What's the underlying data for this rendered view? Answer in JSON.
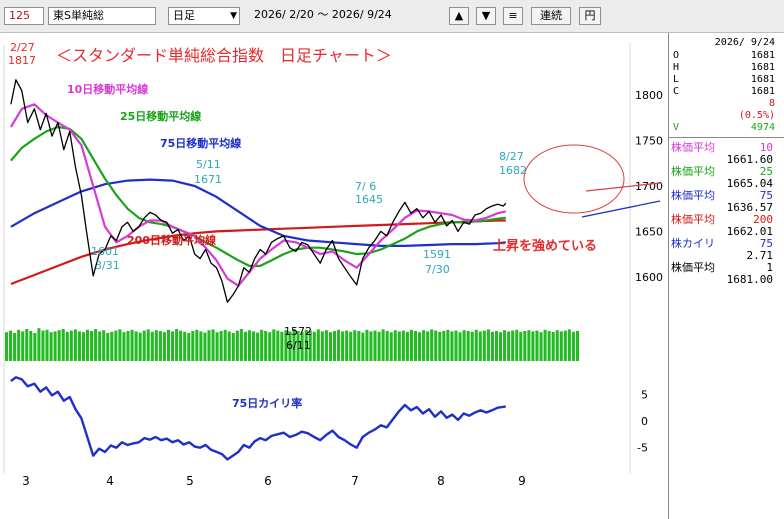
{
  "toolbar": {
    "code": "125",
    "name": "東S単純総",
    "period": "日足",
    "range": "2026/ 2/20 ～  2026/ 9/24",
    "up_icon": "triangle-up-icon",
    "down_icon": "triangle-down-icon",
    "menu_icon": "menu-icon",
    "continuous_label": "連続",
    "yen_label": "円"
  },
  "ohlc": {
    "date": "2026/ 9/24",
    "o_label": "O",
    "o": "1681",
    "h_label": "H",
    "h": "1681",
    "l_label": "L",
    "l": "1681",
    "c_label": "C",
    "c": "1681",
    "change": "8",
    "change_pct": "(0.5%)",
    "v_label": "V",
    "v": "4974"
  },
  "indicators": [
    {
      "label": "株価平均",
      "period": "10",
      "value": "1661.60",
      "color": "#d63bd6"
    },
    {
      "label": "株価平均",
      "period": "25",
      "value": "1665.04",
      "color": "#1aa31a"
    },
    {
      "label": "株価平均",
      "period": "75",
      "value": "1636.57",
      "color": "#1f2fc8"
    },
    {
      "label": "株価平均",
      "period": "200",
      "value": "1662.01",
      "color": "#d11a1a"
    },
    {
      "label": "株カイリ",
      "period": "75",
      "value": "2.71",
      "color": "#1f2fc8"
    },
    {
      "label": "株価平均",
      "period": "1",
      "value": "1681.00",
      "color": "#000000"
    }
  ],
  "annotations": {
    "title": "＜スタンダード単純総合指数　日足チャート＞",
    "ma10": "10日移動平均線",
    "ma25": "25日移動平均線",
    "ma75": "75日移動平均線",
    "ma200": "200日移動平均線",
    "kairi": "75日カイリ率",
    "trend": "上昇を強めている",
    "p1_date": "2/27",
    "p1_val": "1817",
    "p2_date": "5/11",
    "p2_val": "1671",
    "p3_val": "1601",
    "p3_date": "3/31",
    "p4_val": "1572",
    "p4_date": "6/11",
    "p5_date": "7/ 6",
    "p5_val": "1645",
    "p6_val": "1591",
    "p6_date": "7/30",
    "p7_date": "8/27",
    "p7_val": "1682"
  },
  "chart_data": [
    {
      "type": "line",
      "title": "＜スタンダード単純総合指数　日足チャート＞",
      "x_labels": [
        "3",
        "4",
        "5",
        "6",
        "7",
        "8",
        "9"
      ],
      "ylim": [
        1570,
        1830
      ],
      "yticks": [
        1600,
        1650,
        1700,
        1750,
        1800
      ],
      "grid": false,
      "series": [
        {
          "name": "",
          "color": "#000000",
          "x": [
            2.82,
            2.88,
            2.95,
            3.02,
            3.1,
            3.17,
            3.24,
            3.31,
            3.38,
            3.45,
            3.52,
            3.59,
            3.66,
            3.72,
            3.8,
            3.87,
            3.94,
            4.01,
            4.08,
            4.15,
            4.22,
            4.29,
            4.36,
            4.43,
            4.5,
            4.57,
            4.64,
            4.71,
            4.78,
            4.85,
            4.92,
            4.99,
            5.06,
            5.13,
            5.2,
            5.27,
            5.34,
            5.41,
            5.48,
            5.55,
            5.62,
            5.69,
            5.76,
            5.83,
            5.9,
            5.97,
            6.04,
            6.11,
            6.18,
            6.25,
            6.32,
            6.39,
            6.46,
            6.53,
            6.6,
            6.67,
            6.74,
            6.81,
            6.88,
            6.95,
            7.02,
            7.09,
            7.16,
            7.23,
            7.3,
            7.37,
            7.44,
            7.51,
            7.58,
            7.65,
            7.72,
            7.79,
            7.86,
            7.93,
            8.0,
            8.07,
            8.14,
            8.21,
            8.28,
            8.35,
            8.42,
            8.49,
            8.56,
            8.63,
            8.7,
            8.77,
            8.8
          ],
          "y": [
            1790,
            1817,
            1805,
            1770,
            1785,
            1762,
            1780,
            1755,
            1770,
            1740,
            1760,
            1720,
            1690,
            1650,
            1601,
            1625,
            1630,
            1645,
            1640,
            1655,
            1660,
            1650,
            1655,
            1665,
            1671,
            1668,
            1662,
            1660,
            1648,
            1652,
            1640,
            1645,
            1625,
            1620,
            1630,
            1615,
            1610,
            1595,
            1572,
            1580,
            1590,
            1610,
            1605,
            1620,
            1630,
            1625,
            1638,
            1642,
            1645,
            1632,
            1628,
            1638,
            1635,
            1625,
            1615,
            1630,
            1640,
            1620,
            1610,
            1600,
            1591,
            1620,
            1632,
            1640,
            1650,
            1645,
            1660,
            1672,
            1682,
            1670,
            1675,
            1665,
            1672,
            1660,
            1668,
            1656,
            1662,
            1650,
            1660,
            1658,
            1668,
            1670,
            1675,
            1678,
            1680,
            1678,
            1681
          ]
        },
        {
          "name": "",
          "color": "#d63bd6",
          "x": [
            2.82,
            2.95,
            3.1,
            3.24,
            3.38,
            3.52,
            3.66,
            3.8,
            3.94,
            4.08,
            4.22,
            4.36,
            4.5,
            4.64,
            4.78,
            4.92,
            5.06,
            5.2,
            5.34,
            5.48,
            5.62,
            5.76,
            5.9,
            6.04,
            6.18,
            6.32,
            6.46,
            6.6,
            6.74,
            6.88,
            7.02,
            7.16,
            7.3,
            7.44,
            7.58,
            7.72,
            7.86,
            8.0,
            8.14,
            8.28,
            8.42,
            8.56,
            8.7,
            8.8
          ],
          "y": [
            1765,
            1785,
            1790,
            1778,
            1770,
            1762,
            1745,
            1700,
            1655,
            1638,
            1645,
            1655,
            1662,
            1662,
            1655,
            1650,
            1645,
            1632,
            1618,
            1598,
            1590,
            1605,
            1620,
            1630,
            1640,
            1638,
            1632,
            1625,
            1628,
            1618,
            1610,
            1625,
            1640,
            1652,
            1665,
            1673,
            1672,
            1670,
            1668,
            1663,
            1662,
            1665,
            1670,
            1672
          ]
        },
        {
          "name": "",
          "color": "#1aa31a",
          "x": [
            2.82,
            2.95,
            3.1,
            3.24,
            3.38,
            3.52,
            3.66,
            3.8,
            3.94,
            4.08,
            4.22,
            4.36,
            4.5,
            4.64,
            4.78,
            4.92,
            5.06,
            5.2,
            5.34,
            5.48,
            5.62,
            5.76,
            5.9,
            6.04,
            6.18,
            6.32,
            6.46,
            6.6,
            6.74,
            6.88,
            7.02,
            7.16,
            7.3,
            7.44,
            7.58,
            7.72,
            7.86,
            8.0,
            8.14,
            8.28,
            8.42,
            8.56,
            8.7,
            8.8
          ],
          "y": [
            1728,
            1742,
            1752,
            1760,
            1765,
            1763,
            1752,
            1730,
            1708,
            1690,
            1675,
            1665,
            1660,
            1658,
            1655,
            1650,
            1645,
            1638,
            1632,
            1625,
            1618,
            1612,
            1612,
            1618,
            1625,
            1630,
            1632,
            1632,
            1630,
            1628,
            1625,
            1626,
            1630,
            1636,
            1642,
            1650,
            1655,
            1658,
            1660,
            1660,
            1661,
            1662,
            1664,
            1665
          ]
        },
        {
          "name": "",
          "color": "#1f2fc8",
          "x": [
            2.82,
            3.1,
            3.38,
            3.66,
            3.94,
            4.22,
            4.5,
            4.78,
            5.06,
            5.34,
            5.62,
            5.9,
            6.18,
            6.46,
            6.74,
            7.02,
            7.3,
            7.58,
            7.86,
            8.14,
            8.42,
            8.7,
            8.8
          ],
          "y": [
            1655,
            1670,
            1682,
            1694,
            1702,
            1706,
            1707,
            1706,
            1700,
            1688,
            1672,
            1656,
            1645,
            1640,
            1638,
            1636,
            1634,
            1634,
            1635,
            1636,
            1636,
            1637,
            1638
          ]
        },
        {
          "name": "",
          "color": "#d11a1a",
          "x": [
            2.82,
            3.1,
            3.38,
            3.66,
            3.94,
            4.22,
            4.5,
            4.78,
            5.06,
            5.34,
            5.62,
            5.9,
            6.18,
            6.46,
            6.74,
            7.02,
            7.3,
            7.58,
            7.86,
            8.14,
            8.42,
            8.7,
            8.8
          ],
          "y": [
            1592,
            1602,
            1612,
            1622,
            1630,
            1636,
            1641,
            1645,
            1648,
            1650,
            1651,
            1652,
            1653,
            1654,
            1655,
            1656,
            1657,
            1658,
            1659,
            1660,
            1661,
            1662,
            1662
          ]
        }
      ]
    },
    {
      "type": "bar",
      "title": "",
      "series": [
        {
          "name": "",
          "color": "#22bb22",
          "values": [
            0.72,
            0.76,
            0.7,
            0.78,
            0.74,
            0.8,
            0.75,
            0.7,
            0.82,
            0.76,
            0.78,
            0.72,
            0.74,
            0.77,
            0.8,
            0.73,
            0.76,
            0.79,
            0.74,
            0.72,
            0.78,
            0.75,
            0.8,
            0.74,
            0.77,
            0.7,
            0.73,
            0.76,
            0.79,
            0.72,
            0.75,
            0.78,
            0.74,
            0.71,
            0.76,
            0.79,
            0.73,
            0.77,
            0.75,
            0.72,
            0.78,
            0.74,
            0.8,
            0.76,
            0.73,
            0.7,
            0.75,
            0.78,
            0.74,
            0.71,
            0.77,
            0.79,
            0.72,
            0.75,
            0.78,
            0.74,
            0.7,
            0.76,
            0.8,
            0.73,
            0.77,
            0.74,
            0.71,
            0.78,
            0.75,
            0.72,
            0.79,
            0.76,
            0.73,
            0.77,
            0.74,
            0.8,
            0.75,
            0.72,
            0.78,
            0.76,
            0.73,
            0.79,
            0.74,
            0.77,
            0.72,
            0.75,
            0.78,
            0.74,
            0.76,
            0.73,
            0.77,
            0.75,
            0.71,
            0.78,
            0.74,
            0.76,
            0.73,
            0.79,
            0.75,
            0.72,
            0.77,
            0.74,
            0.76,
            0.73,
            0.78,
            0.75,
            0.72,
            0.77,
            0.74,
            0.79,
            0.76,
            0.73,
            0.75,
            0.78,
            0.74,
            0.76,
            0.72,
            0.77,
            0.75,
            0.73,
            0.78,
            0.74,
            0.76,
            0.79,
            0.73,
            0.75,
            0.72,
            0.77,
            0.74,
            0.76,
            0.78,
            0.73,
            0.75,
            0.77,
            0.74,
            0.76,
            0.72,
            0.78,
            0.75,
            0.73,
            0.77,
            0.74,
            0.76,
            0.79,
            0.73,
            0.75
          ]
        }
      ]
    },
    {
      "type": "line",
      "title": "",
      "ylim": [
        -9,
        9
      ],
      "yticks": [
        5,
        0,
        -5
      ],
      "series": [
        {
          "name": "",
          "color": "#1f2fc8",
          "x": [
            2.82,
            2.88,
            2.95,
            3.02,
            3.1,
            3.17,
            3.24,
            3.31,
            3.38,
            3.45,
            3.52,
            3.59,
            3.66,
            3.73,
            3.8,
            3.87,
            3.94,
            4.01,
            4.08,
            4.15,
            4.22,
            4.29,
            4.36,
            4.43,
            4.5,
            4.57,
            4.64,
            4.71,
            4.78,
            4.85,
            4.92,
            4.99,
            5.06,
            5.13,
            5.2,
            5.27,
            5.34,
            5.41,
            5.48,
            5.55,
            5.62,
            5.69,
            5.76,
            5.83,
            5.9,
            5.97,
            6.04,
            6.11,
            6.18,
            6.25,
            6.32,
            6.39,
            6.46,
            6.53,
            6.6,
            6.67,
            6.74,
            6.81,
            6.88,
            6.95,
            7.02,
            7.09,
            7.16,
            7.23,
            7.3,
            7.37,
            7.44,
            7.51,
            7.58,
            7.65,
            7.72,
            7.79,
            7.86,
            7.93,
            8.0,
            8.07,
            8.14,
            8.21,
            8.28,
            8.35,
            8.42,
            8.49,
            8.56,
            8.63,
            8.7,
            8.8
          ],
          "y": [
            7.5,
            8.2,
            7.8,
            6.5,
            7.0,
            5.5,
            6.3,
            4.8,
            5.5,
            3.8,
            4.5,
            2.2,
            0.5,
            -3.0,
            -6.5,
            -5.2,
            -5.8,
            -4.6,
            -5.0,
            -4.0,
            -4.5,
            -4.2,
            -4.0,
            -3.2,
            -3.5,
            -3.0,
            -3.6,
            -3.3,
            -4.0,
            -3.6,
            -4.4,
            -4.0,
            -4.8,
            -5.0,
            -4.5,
            -5.4,
            -5.8,
            -6.2,
            -7.2,
            -6.5,
            -5.8,
            -4.5,
            -5.0,
            -3.8,
            -3.2,
            -3.6,
            -2.8,
            -2.5,
            -2.2,
            -3.0,
            -2.6,
            -2.0,
            -2.3,
            -3.0,
            -3.6,
            -2.6,
            -1.8,
            -3.0,
            -3.6,
            -4.4,
            -5.0,
            -3.0,
            -2.2,
            -1.6,
            -0.8,
            -1.2,
            0.3,
            1.8,
            3.0,
            2.0,
            2.6,
            1.4,
            2.2,
            0.8,
            1.8,
            0.6,
            1.2,
            0.2,
            1.4,
            1.0,
            1.6,
            2.0,
            1.6,
            2.0,
            2.5,
            2.71
          ]
        }
      ]
    }
  ]
}
